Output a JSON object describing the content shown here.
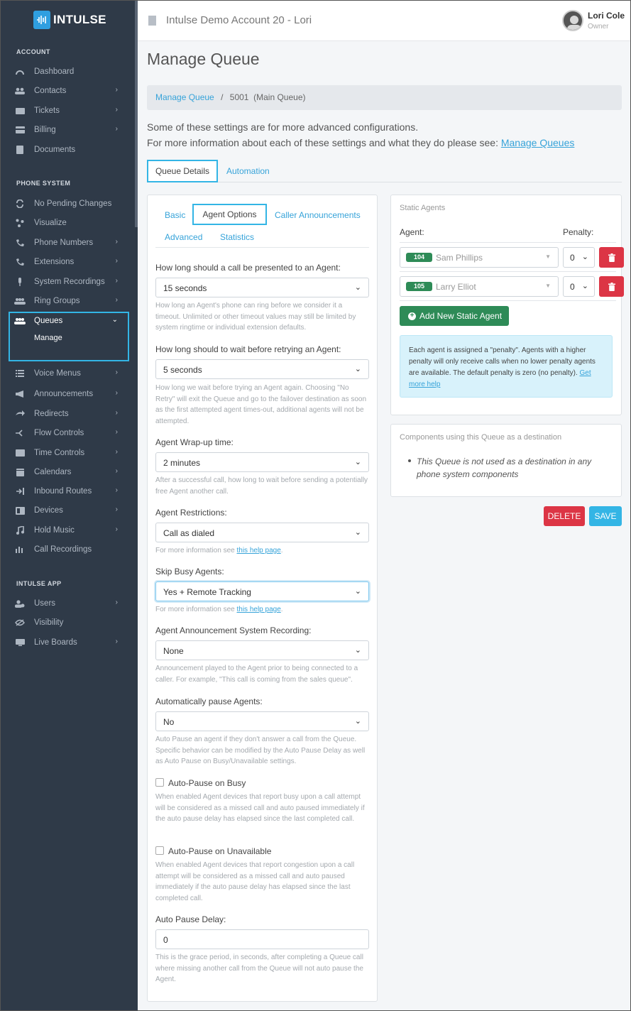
{
  "brand": {
    "name": "INTULSE",
    "accent": "#2f9fe0"
  },
  "sidebar": {
    "sections": {
      "account": "ACCOUNT",
      "phone_system": "PHONE SYSTEM",
      "intulse_app": "INTULSE APP"
    },
    "account_items": [
      {
        "label": "Dashboard",
        "icon": "dashboard-icon"
      },
      {
        "label": "Contacts",
        "icon": "contacts-icon"
      },
      {
        "label": "Tickets",
        "icon": "tickets-icon"
      },
      {
        "label": "Billing",
        "icon": "billing-icon"
      },
      {
        "label": "Documents",
        "icon": "documents-icon"
      }
    ],
    "phone_items": [
      {
        "label": "No Pending Changes",
        "icon": "sync-icon"
      },
      {
        "label": "Visualize",
        "icon": "visualize-icon"
      },
      {
        "label": "Phone Numbers",
        "icon": "phone-numbers-icon"
      },
      {
        "label": "Extensions",
        "icon": "extensions-icon"
      },
      {
        "label": "System Recordings",
        "icon": "microphone-icon"
      },
      {
        "label": "Ring Groups",
        "icon": "ring-groups-icon"
      },
      {
        "label": "Queues",
        "icon": "queues-icon"
      },
      {
        "label": "Voice Menus",
        "icon": "voice-menus-icon"
      },
      {
        "label": "Announcements",
        "icon": "megaphone-icon"
      },
      {
        "label": "Redirects",
        "icon": "redirect-icon"
      },
      {
        "label": "Flow Controls",
        "icon": "flow-icon"
      },
      {
        "label": "Time Controls",
        "icon": "clock-icon"
      },
      {
        "label": "Calendars",
        "icon": "calendar-icon"
      },
      {
        "label": "Inbound Routes",
        "icon": "inbound-icon"
      },
      {
        "label": "Devices",
        "icon": "devices-icon"
      },
      {
        "label": "Hold Music",
        "icon": "music-icon"
      },
      {
        "label": "Call Recordings",
        "icon": "recording-icon"
      }
    ],
    "queues_sub": "Manage",
    "app_items": [
      {
        "label": "Users",
        "icon": "users-icon"
      },
      {
        "label": "Visibility",
        "icon": "visibility-icon"
      },
      {
        "label": "Live Boards",
        "icon": "live-boards-icon"
      }
    ]
  },
  "topbar": {
    "account": "Intulse Demo Account 20 - Lori",
    "user_name": "Lori Cole",
    "user_role": "Owner"
  },
  "page": {
    "title": "Manage Queue",
    "breadcrumb": {
      "link": "Manage Queue",
      "sep": "/",
      "current": "5001  (Main Queue)"
    },
    "info_line1": "Some of these settings are for more advanced configurations.",
    "info_line2": "For more information about each of these settings and what they do please see:",
    "info_link": "Manage Queues",
    "tabs": [
      "Queue Details",
      "Automation"
    ]
  },
  "agent_form": {
    "subtabs": [
      "Basic",
      "Agent Options",
      "Caller Announcements",
      "Advanced",
      "Statistics"
    ],
    "present_label": "How long should a call be presented to an Agent:",
    "present_value": "15 seconds",
    "present_help": "How long an Agent's phone can ring before we consider it a timeout. Unlimited or other timeout values may still be limited by system ringtime or individual extension defaults.",
    "retry_label": "How long should to wait before retrying an Agent:",
    "retry_value": "5 seconds",
    "retry_help": "How long we wait before trying an Agent again. Choosing \"No Retry\" will exit the Queue and go to the failover destination as soon as the first attempted agent times-out, additional agents will not be attempted.",
    "wrapup_label": "Agent Wrap-up time:",
    "wrapup_value": "2 minutes",
    "wrapup_help": "After a successful call, how long to wait before sending a potentially free Agent another call.",
    "restrict_label": "Agent Restrictions:",
    "restrict_value": "Call as dialed",
    "more_info": "For more information see",
    "help_link": "this help page",
    "skip_label": "Skip Busy Agents:",
    "skip_value": "Yes + Remote Tracking",
    "announce_label": "Agent Announcement System Recording:",
    "announce_value": "None",
    "announce_help": "Announcement played to the Agent prior to being connected to a caller. For example, \"This call is coming from the sales queue\".",
    "autopause_label": "Automatically pause Agents:",
    "autopause_value": "No",
    "autopause_help": "Auto Pause an agent if they don't answer a call from the Queue. Specific behavior can be modified by the Auto Pause Delay as well as Auto Pause on Busy/Unavailable settings.",
    "busy_label": "Auto-Pause on Busy",
    "busy_help": "When enabled Agent devices that report busy upon a call attempt will be considered as a missed call and auto paused immediately if the auto pause delay has elapsed since the last completed call.",
    "unavail_label": "Auto-Pause on Unavailable",
    "unavail_help": "When enabled Agent devices that report congestion upon a call attempt will be considered as a missed call and auto paused immediately if the auto pause delay has elapsed since the last completed call.",
    "delay_label": "Auto Pause Delay:",
    "delay_value": "0",
    "delay_help": "This is the grace period, in seconds, after completing a Queue call where missing another call from the Queue will not auto pause the Agent."
  },
  "static_agents": {
    "title": "Static Agents",
    "agent_col": "Agent:",
    "penalty_col": "Penalty:",
    "rows": [
      {
        "ext": "104",
        "name": "Sam Phillips",
        "penalty": "0"
      },
      {
        "ext": "105",
        "name": "Larry Elliot",
        "penalty": "0"
      }
    ],
    "add_label": "Add New Static Agent",
    "alert": "Each agent is assigned a \"penalty\". Agents with a higher penalty will only receive calls when no lower penalty agents are available. The default penalty is zero (no penalty).",
    "alert_link": "Get more help"
  },
  "components": {
    "title": "Components using this Queue as a destination",
    "item": "This Queue is not used as a destination in any phone system components"
  },
  "actions": {
    "delete": "DELETE",
    "save": "SAVE"
  }
}
